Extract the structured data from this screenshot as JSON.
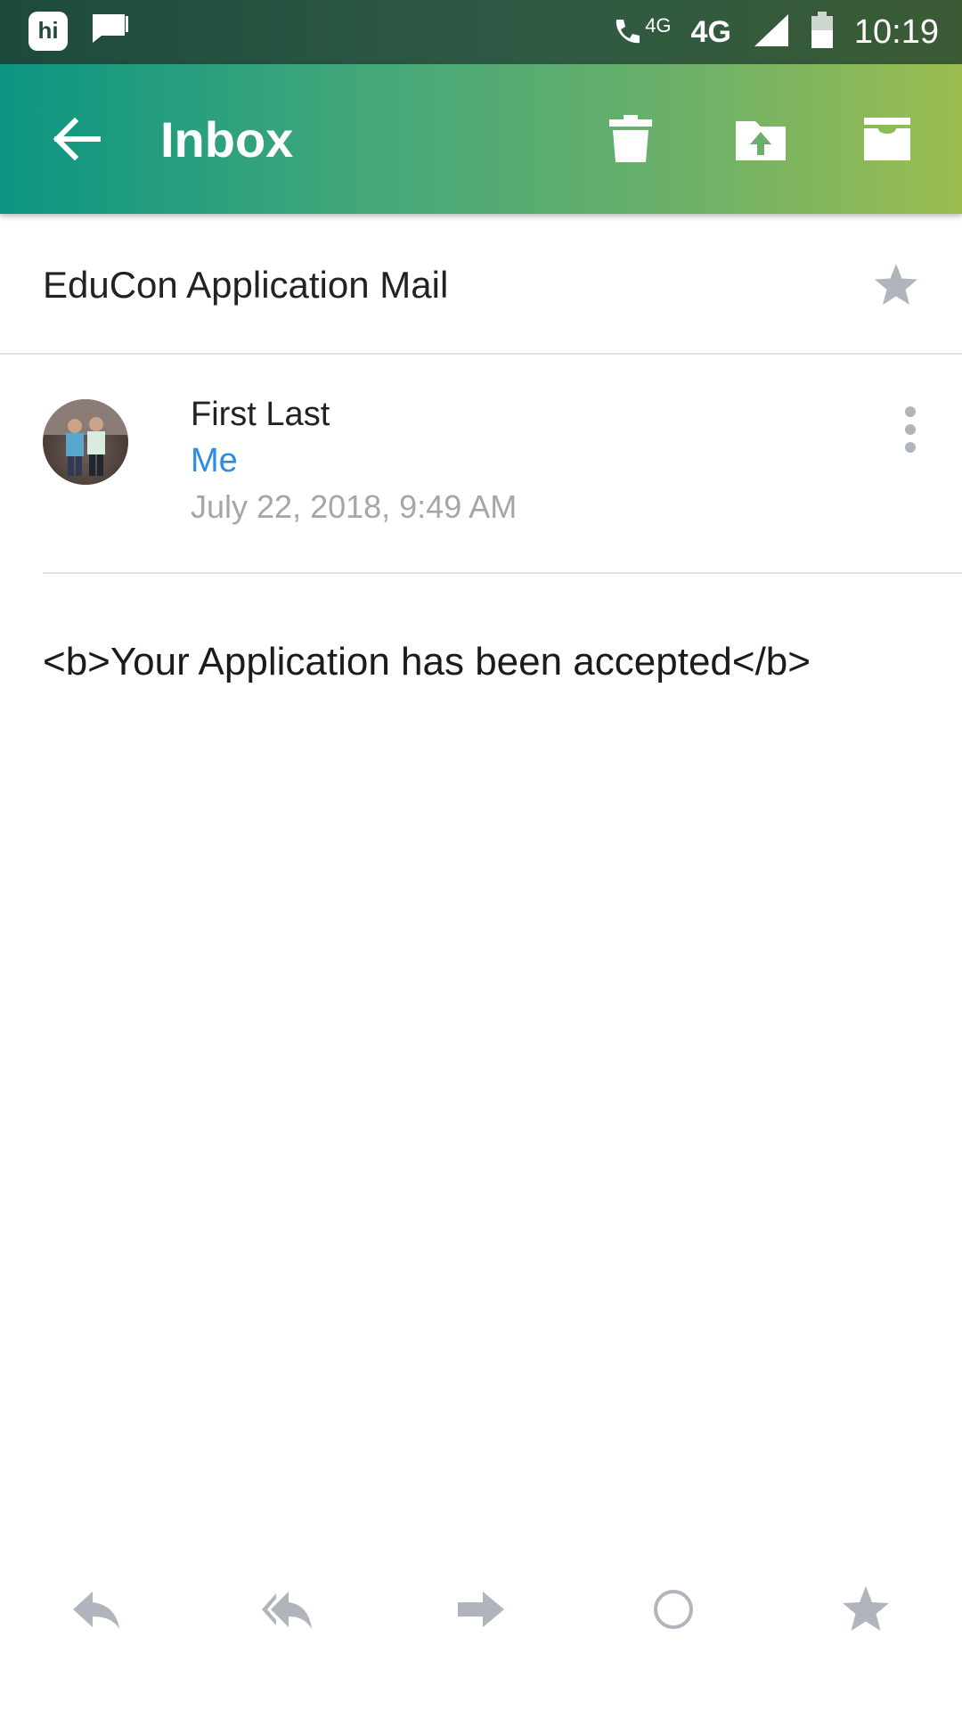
{
  "status_bar": {
    "hi_badge_label": "hi",
    "call_network_label": "4G",
    "network_label": "4G",
    "time": "10:19"
  },
  "app_bar": {
    "title": "Inbox",
    "icons": [
      "back-arrow-icon",
      "delete-icon",
      "move-folder-icon",
      "archive-icon"
    ]
  },
  "subject": {
    "text": "EduCon Application Mail",
    "star_icon": "star-icon"
  },
  "message": {
    "sender": "First Last",
    "recipient": "Me",
    "date": "July 22, 2018, 9:49 AM",
    "body": "<b>Your Application has been accepted</b>"
  },
  "actions": [
    "reply-icon",
    "reply-all-icon",
    "forward-icon",
    "circle-icon",
    "star-icon"
  ],
  "colors": {
    "accent_start": "#0b9582",
    "accent_end": "#9bbd50",
    "recipient": "#2e8be4",
    "muted": "#a6a6a6",
    "icon_gray": "#b0b4bc"
  }
}
